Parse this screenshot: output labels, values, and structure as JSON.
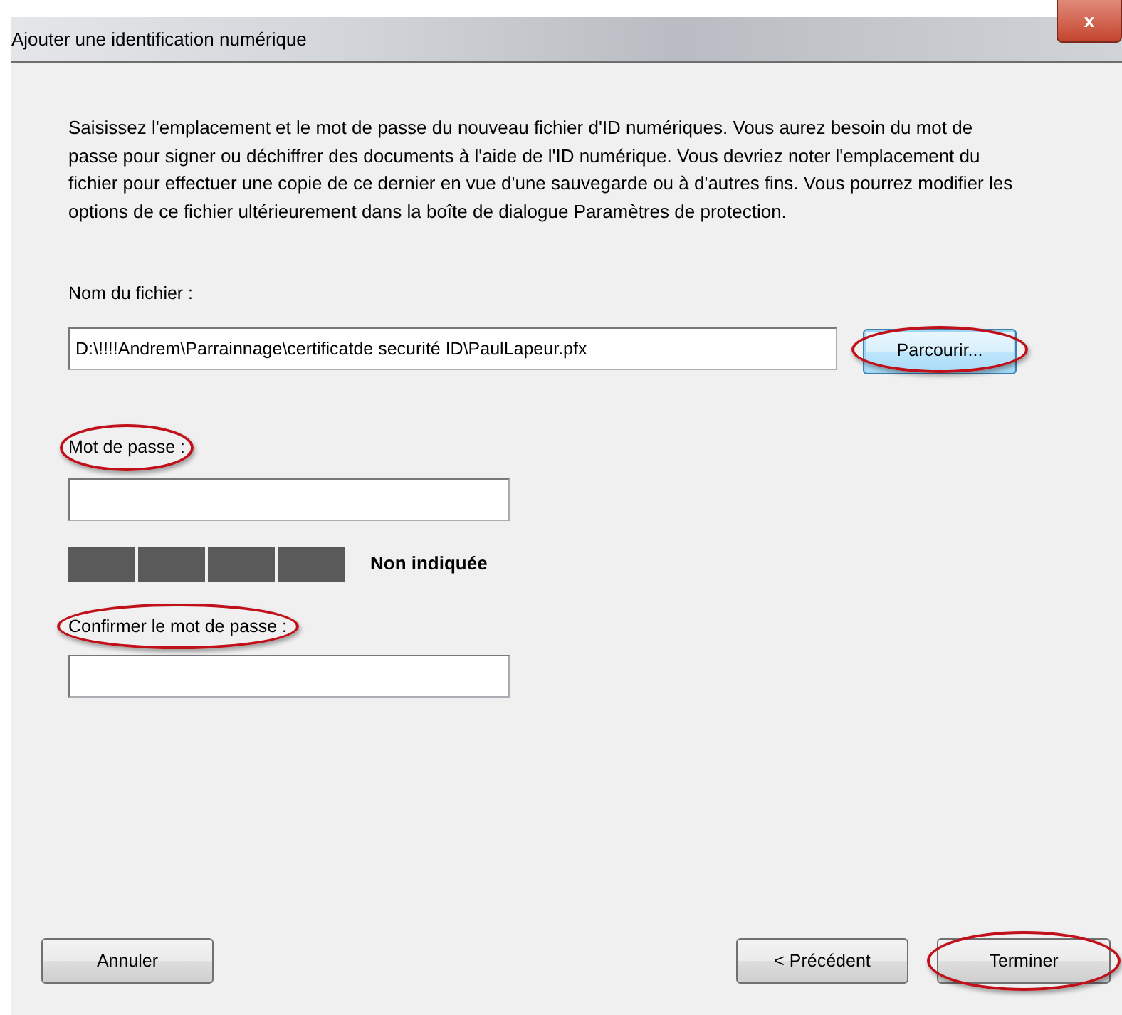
{
  "window": {
    "title": "Ajouter une identification numérique",
    "close_label": "x"
  },
  "intro": "Saisissez l'emplacement et le mot de passe du nouveau fichier d'ID numériques. Vous aurez besoin du mot de passe pour signer ou déchiffrer des documents à l'aide de l'ID numérique. Vous devriez noter l'emplacement du fichier pour effectuer une copie de ce dernier en vue d'une sauvegarde ou à d'autres fins. Vous pourrez modifier les options de ce fichier ultérieurement dans la boîte de dialogue Paramètres de protection.",
  "file": {
    "label": "Nom du fichier :",
    "label_highlighted": false,
    "value": "D:\\!!!!Andrem\\Parrainnage\\certificatde securité ID\\PaulLapeur.pfx",
    "browse": {
      "label": "Parcourir...",
      "highlighted": true,
      "focused": true
    }
  },
  "password": {
    "label": "Mot de passe :",
    "label_highlighted": true
  },
  "strength": {
    "level": 0,
    "reading": "Non indiquée"
  },
  "confirm": {
    "label": "Confirmer le mot de passe :",
    "label_highlighted": true
  },
  "buttons": [
    {
      "label": "Annuler",
      "highlighted": false
    },
    {
      "label": "< Précédent",
      "highlighted": false
    },
    {
      "label": "Terminer",
      "highlighted": true
    }
  ]
}
